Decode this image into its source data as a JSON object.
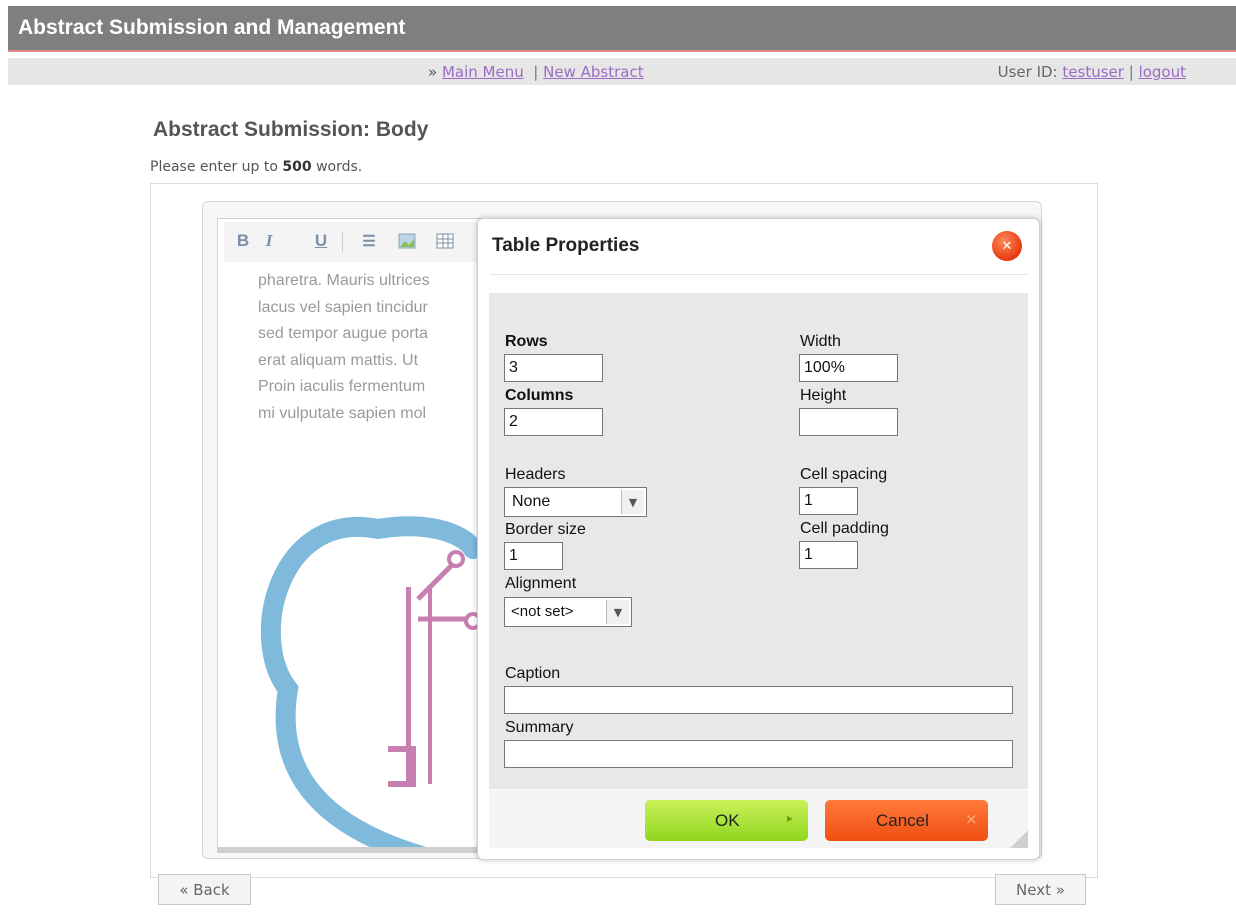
{
  "app": {
    "title": "Abstract Submission and Management"
  },
  "nav": {
    "prefix": "»",
    "main_menu": "Main Menu",
    "divider": "|",
    "new_abstract": "New Abstract",
    "user_label": "User ID:",
    "user_id": "testuser",
    "user_divider": "|",
    "logout": "logout"
  },
  "page": {
    "heading": "Abstract Submission: Body",
    "instructions_before": "Please enter up to",
    "word_limit": "500",
    "instructions_after": "words."
  },
  "toolbar": {
    "bold": "B",
    "italic": "I",
    "underline": "U",
    "icons": [
      "bold-icon",
      "italic-icon",
      "underline-icon",
      "bulleted-list-icon",
      "insert-image-icon",
      "insert-table-icon"
    ]
  },
  "editor": {
    "lines": [
      "pharetra. Mauris ultrices",
      "lacus vel sapien tincidur",
      "sed tempor augue porta",
      "erat aliquam mattis. Ut",
      "Proin iaculis fermentum",
      "mi vulputate sapien mol"
    ],
    "logo_colors": {
      "ear": "#7fb9dc",
      "instrument": "#c77fb0"
    }
  },
  "dialog": {
    "title": "Table Properties",
    "close_icon": "close-icon",
    "rows_label": "Rows",
    "rows_value": "3",
    "columns_label": "Columns",
    "columns_value": "2",
    "width_label": "Width",
    "width_value": "100%",
    "height_label": "Height",
    "height_value": "",
    "headers_label": "Headers",
    "headers_value": "None",
    "border_label": "Border size",
    "border_value": "1",
    "alignment_label": "Alignment",
    "alignment_value": "<not set>",
    "cell_spacing_label": "Cell spacing",
    "cell_spacing_value": "1",
    "cell_padding_label": "Cell padding",
    "cell_padding_value": "1",
    "caption_label": "Caption",
    "caption_value": "",
    "summary_label": "Summary",
    "summary_value": "",
    "ok_label": "OK",
    "cancel_label": "Cancel",
    "ok_icon": "▸",
    "cancel_icon": "×"
  },
  "footer": {
    "back_label": "« Back",
    "next_label": "Next »"
  },
  "colors": {
    "header_bg": "#7f7f7f",
    "link": "#9c6bc4",
    "ok": "#a6e23a",
    "cancel": "#f55a1e",
    "close": "#e83a10"
  }
}
